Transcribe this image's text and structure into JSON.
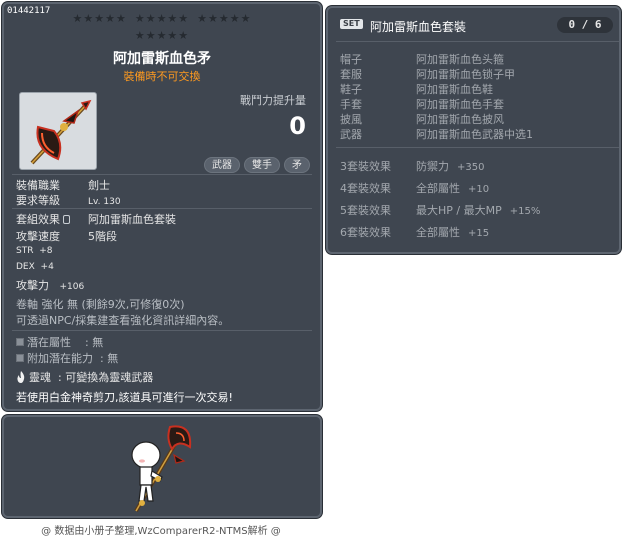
{
  "item": {
    "id": "01442117",
    "name": "阿加雷斯血色矛",
    "trade_note": "裝備時不可交換",
    "power_label": "戰鬥力提升量",
    "power_value": "0",
    "tags": [
      "武器",
      "雙手",
      "矛"
    ],
    "job_label": "裝備職業",
    "job_value": "劍士",
    "level_label": "要求等級",
    "level_value": "Lv. 130",
    "set_label": "套組效果",
    "set_value": "阿加雷斯血色套裝",
    "speed_label": "攻擊速度",
    "speed_value": "5階段",
    "str_label": "STR",
    "str_value": "+8",
    "dex_label": "DEX",
    "dex_value": "+4",
    "atk_label": "攻擊力",
    "atk_value": "+106",
    "scroll_line": "卷軸 強化 無 (剩餘9次,可修復0次)",
    "enhance_note": "可透過NPC/採集建查看強化資訊詳細內容。",
    "potential_label": "潛在屬性",
    "potential_value": ": 無",
    "bonus_potential_label": "附加潛在能力",
    "bonus_potential_value": ": 無",
    "soul_label": "靈魂",
    "soul_value": ": 可變換為靈魂武器",
    "scissors_note": "若使用白金神奇剪刀,該道具可進行一次交易!"
  },
  "set": {
    "badge": "SET",
    "title": "阿加雷斯血色套裝",
    "count": "0 / 6",
    "pieces": [
      {
        "slot": "帽子",
        "name": "阿加雷斯血色头箍"
      },
      {
        "slot": "套服",
        "name": "阿加雷斯血色锁子甲"
      },
      {
        "slot": "鞋子",
        "name": "阿加雷斯血色鞋"
      },
      {
        "slot": "手套",
        "name": "阿加雷斯血色手套"
      },
      {
        "slot": "披風",
        "name": "阿加雷斯血色披风"
      },
      {
        "slot": "武器",
        "name": "阿加雷斯血色武器中选1"
      }
    ],
    "effects": [
      {
        "tier": "3套裝效果",
        "stat": "防禦力",
        "bonus": "+350"
      },
      {
        "tier": "4套裝效果",
        "stat": "全部屬性",
        "bonus": "+10"
      },
      {
        "tier": "5套裝效果",
        "stat": "最大HP / 最大MP",
        "bonus": "+15%"
      },
      {
        "tier": "6套裝效果",
        "stat": "全部屬性",
        "bonus": "+15"
      }
    ]
  },
  "credit": "@ 数据由小册子整理,WzComparerR2-NTMS解析 @",
  "colors": {
    "panel_bg": "#3f4650",
    "trade_note": "#ff9a1f",
    "star_empty": "#252a30"
  },
  "icons": [
    "axe-spear-weapon-icon",
    "lock-icon",
    "flame-icon",
    "character-preview"
  ]
}
